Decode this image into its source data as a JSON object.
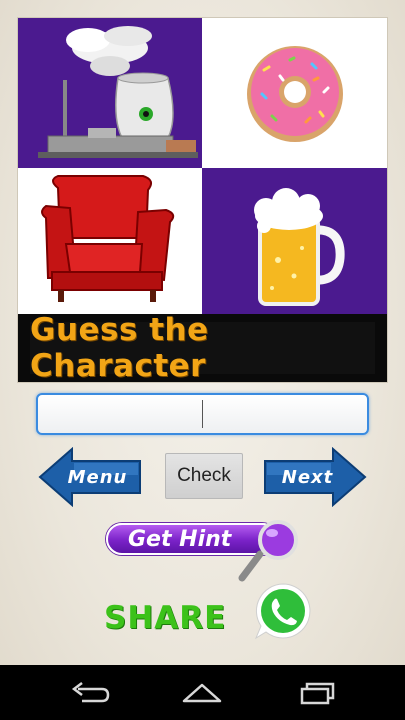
{
  "puzzle": {
    "tiles": [
      {
        "icon": "nuclear-plant-icon"
      },
      {
        "icon": "donut-icon"
      },
      {
        "icon": "armchair-icon"
      },
      {
        "icon": "beer-mug-icon"
      }
    ],
    "banner_text": "Guess the Character"
  },
  "answer": {
    "value": "",
    "placeholder": ""
  },
  "controls": {
    "menu_label": "Menu",
    "check_label": "Check",
    "next_label": "Next"
  },
  "hint": {
    "label": "Get Hint",
    "icon": "magnifier-icon"
  },
  "share": {
    "label": "SHARE",
    "icon": "whatsapp-icon"
  },
  "colors": {
    "tile_purple": "#4b1a8f",
    "banner_text": "#f2a516",
    "arrow_blue": "#1d5fa8",
    "hint_purple": "#7a22c8",
    "share_green": "#3cc21a",
    "input_border": "#3a8be0"
  },
  "system_nav": {
    "icons": [
      "back-icon",
      "home-icon",
      "recent-apps-icon"
    ]
  }
}
